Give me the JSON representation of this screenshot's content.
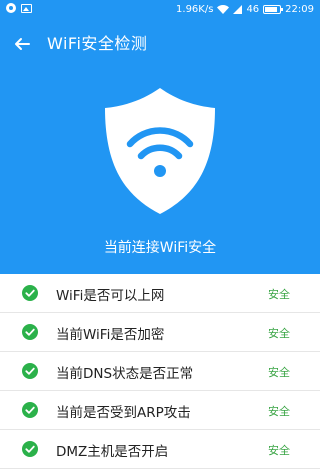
{
  "status_bar": {
    "network_speed": "1.96K/s",
    "signal": "46",
    "time": "22:09"
  },
  "toolbar": {
    "title": "WiFi安全检测"
  },
  "hero": {
    "status_text": "当前连接WiFi安全"
  },
  "checks": [
    {
      "label": "WiFi是否可以上网",
      "status": "安全"
    },
    {
      "label": "当前WiFi是否加密",
      "status": "安全"
    },
    {
      "label": "当前DNS状态是否正常",
      "status": "安全"
    },
    {
      "label": "当前是否受到ARP攻击",
      "status": "安全"
    },
    {
      "label": "DMZ主机是否开启",
      "status": "安全"
    }
  ],
  "colors": {
    "primary": "#2196F3",
    "success": "#3aa545",
    "check_icon": "#2bb14a"
  }
}
